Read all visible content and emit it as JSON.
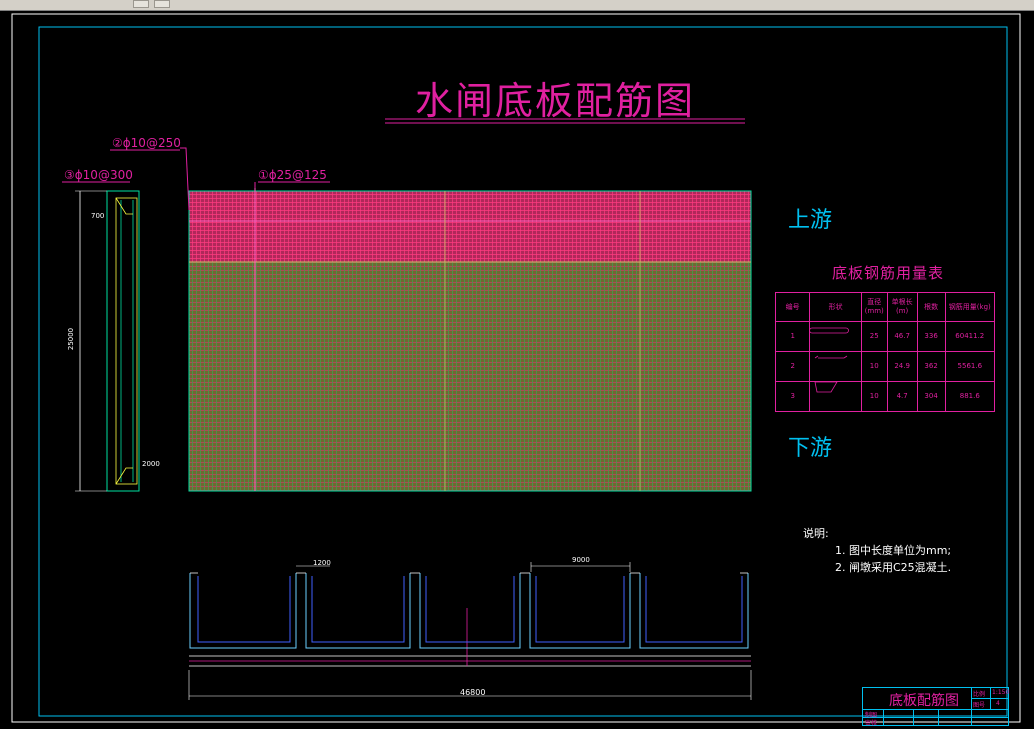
{
  "window": {
    "toolbar_icons": [
      "drawing-tools-icon",
      "palette-icon"
    ]
  },
  "drawing": {
    "title": "水闸底板配筋图",
    "rebar_labels": {
      "rebar1": "①ϕ25@125",
      "rebar2": "②ϕ10@250",
      "rebar3": "③ϕ10@300"
    },
    "side_section": {
      "dim_top": "700",
      "dim_length": "25000",
      "dim_bottom": "2000"
    },
    "upstream_label": "上游",
    "downstream_label": "下游",
    "colors": {
      "outline": "#00c0f0",
      "annotation": "#e020a0",
      "upstream_zone": "#b0285a",
      "downstream_zone": "#6e6a32"
    }
  },
  "rebar_table": {
    "title": "底板钢筋用量表",
    "headers": [
      "编号",
      "形状",
      "直径(mm)",
      "单根长(m)",
      "根数",
      "钢筋用量(kg)"
    ],
    "rows": [
      {
        "id": "1",
        "diameter": "25",
        "length": "46.7",
        "count": "336",
        "weight": "60411.2"
      },
      {
        "id": "2",
        "diameter": "10",
        "length": "24.9",
        "count": "362",
        "weight": "5561.6"
      },
      {
        "id": "3",
        "diameter": "10",
        "length": "4.7",
        "count": "304",
        "weight": "881.6"
      }
    ]
  },
  "elevation": {
    "dim_gap": "1200",
    "dim_bay": "9000",
    "dim_total": "46800"
  },
  "notes": {
    "heading": "说明:",
    "items": [
      "1. 图中长度单位为mm;",
      "2. 闸墩采用C25混凝土."
    ]
  },
  "title_block": {
    "drawing_name": "底板配筋图",
    "field_labels": [
      "比例",
      "1:150",
      "图号",
      "4"
    ],
    "sign_labels": [
      "制图",
      "审核"
    ]
  }
}
